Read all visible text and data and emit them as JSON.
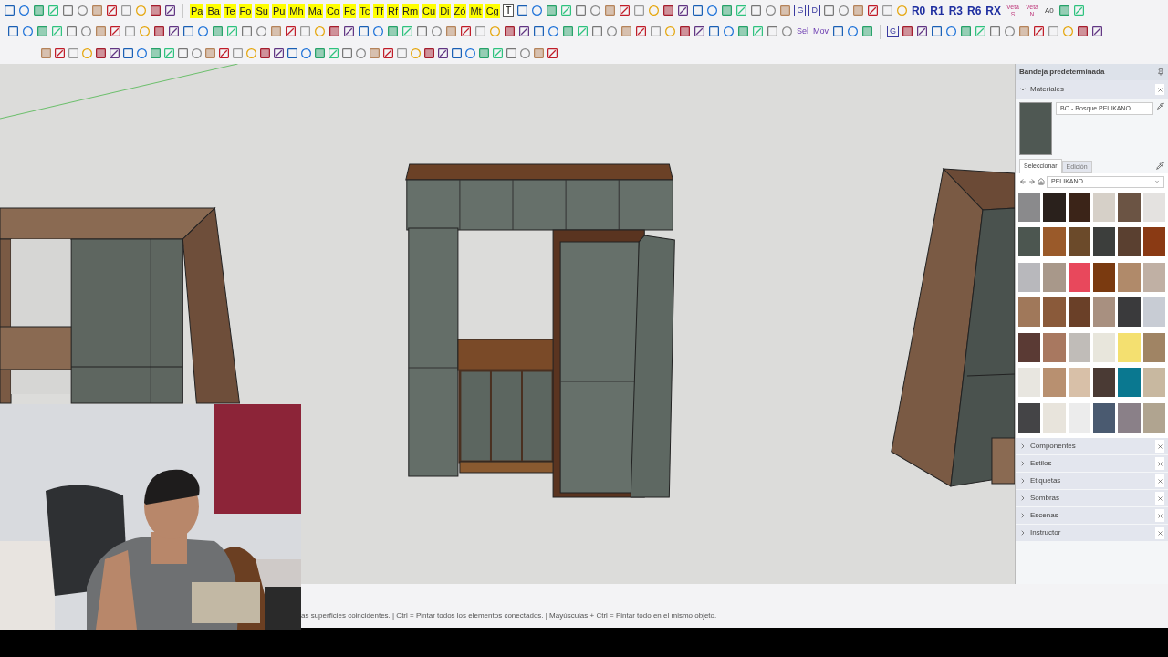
{
  "toolbar": {
    "tool_labels": [
      "Pa",
      "Ba",
      "Te",
      "Fo",
      "Su",
      "Pu",
      "Mh",
      "Ma",
      "Co",
      "Fc",
      "Tc",
      "Tf",
      "Rf",
      "Rm",
      "Cu",
      "Di",
      "Zó",
      "Mt",
      "Cg"
    ],
    "text_button": "T",
    "group_buttons": [
      "G",
      "D"
    ],
    "view_buttons": [
      "R0",
      "R1",
      "R3",
      "R6",
      "RX"
    ],
    "grain_buttons": [
      {
        "top": "Veta",
        "bottom": "S"
      },
      {
        "top": "Veta",
        "bottom": "N"
      }
    ],
    "ao_button": "A0",
    "row2_labels": [
      "Sel",
      "Mov"
    ],
    "row2_group_button": "G"
  },
  "tray": {
    "title": "Bandeja predeterminada",
    "materials": {
      "title": "Materiales",
      "expanded": true,
      "material_name": "BO - Bosque PELIKANO",
      "tabs": [
        {
          "label": "Seleccionar",
          "selected": true
        },
        {
          "label": "Edición",
          "selected": false
        }
      ],
      "library": "PELIKANO",
      "swatches": [
        {
          "color": "#8a8a8c"
        },
        {
          "color": "#2a211c"
        },
        {
          "color": "#3b2418"
        },
        {
          "color": "#d6d0c8"
        },
        {
          "color": "#6b5444"
        },
        {
          "color": "#e4e2e0"
        },
        {
          "color": "#4c5650"
        },
        {
          "color": "#9a5a2a"
        },
        {
          "color": "#6b4a2a"
        },
        {
          "color": "#3c3e3c"
        },
        {
          "color": "#5a4030"
        },
        {
          "color": "#8a3a14"
        },
        {
          "color": "#b8b8bc"
        },
        {
          "color": "#a8988a"
        },
        {
          "color": "#e8485c"
        },
        {
          "color": "#7a3a10"
        },
        {
          "color": "#b08a6a"
        },
        {
          "color": "#c0b0a4"
        },
        {
          "color": "#a0785a"
        },
        {
          "color": "#8a5a3a"
        },
        {
          "color": "#6a4028"
        },
        {
          "color": "#a89080"
        },
        {
          "color": "#3a3a3c"
        },
        {
          "color": "#c8ccd4"
        },
        {
          "color": "#5a3a34"
        },
        {
          "color": "#a87860"
        },
        {
          "color": "#c0bcb8"
        },
        {
          "color": "#e8e6dc"
        },
        {
          "color": "#f4e070"
        },
        {
          "color": "#a08464"
        },
        {
          "color": "#e8e6e0"
        },
        {
          "color": "#b89070"
        },
        {
          "color": "#d8c0a8"
        },
        {
          "color": "#4a3a34"
        },
        {
          "color": "#0a7890"
        },
        {
          "color": "#c8b8a0"
        },
        {
          "color": "#444446"
        },
        {
          "color": "#e8e4dc"
        },
        {
          "color": "#ececec"
        },
        {
          "color": "#4a5a70"
        },
        {
          "color": "#8a8088"
        },
        {
          "color": "#b0a490"
        }
      ]
    },
    "sections": [
      {
        "title": "Componentes",
        "expanded": false
      },
      {
        "title": "Estilos",
        "expanded": false
      },
      {
        "title": "Etiquetas",
        "expanded": false
      },
      {
        "title": "Sombras",
        "expanded": false
      },
      {
        "title": "Escenas",
        "expanded": false
      },
      {
        "title": "Instructor",
        "expanded": false
      }
    ]
  },
  "status_bar": {
    "text": "as superficies coincidentes. | Ctrl = Pintar todos los elementos conectados. | Mayúsculas + Ctrl = Pintar todo en el mismo objeto."
  }
}
